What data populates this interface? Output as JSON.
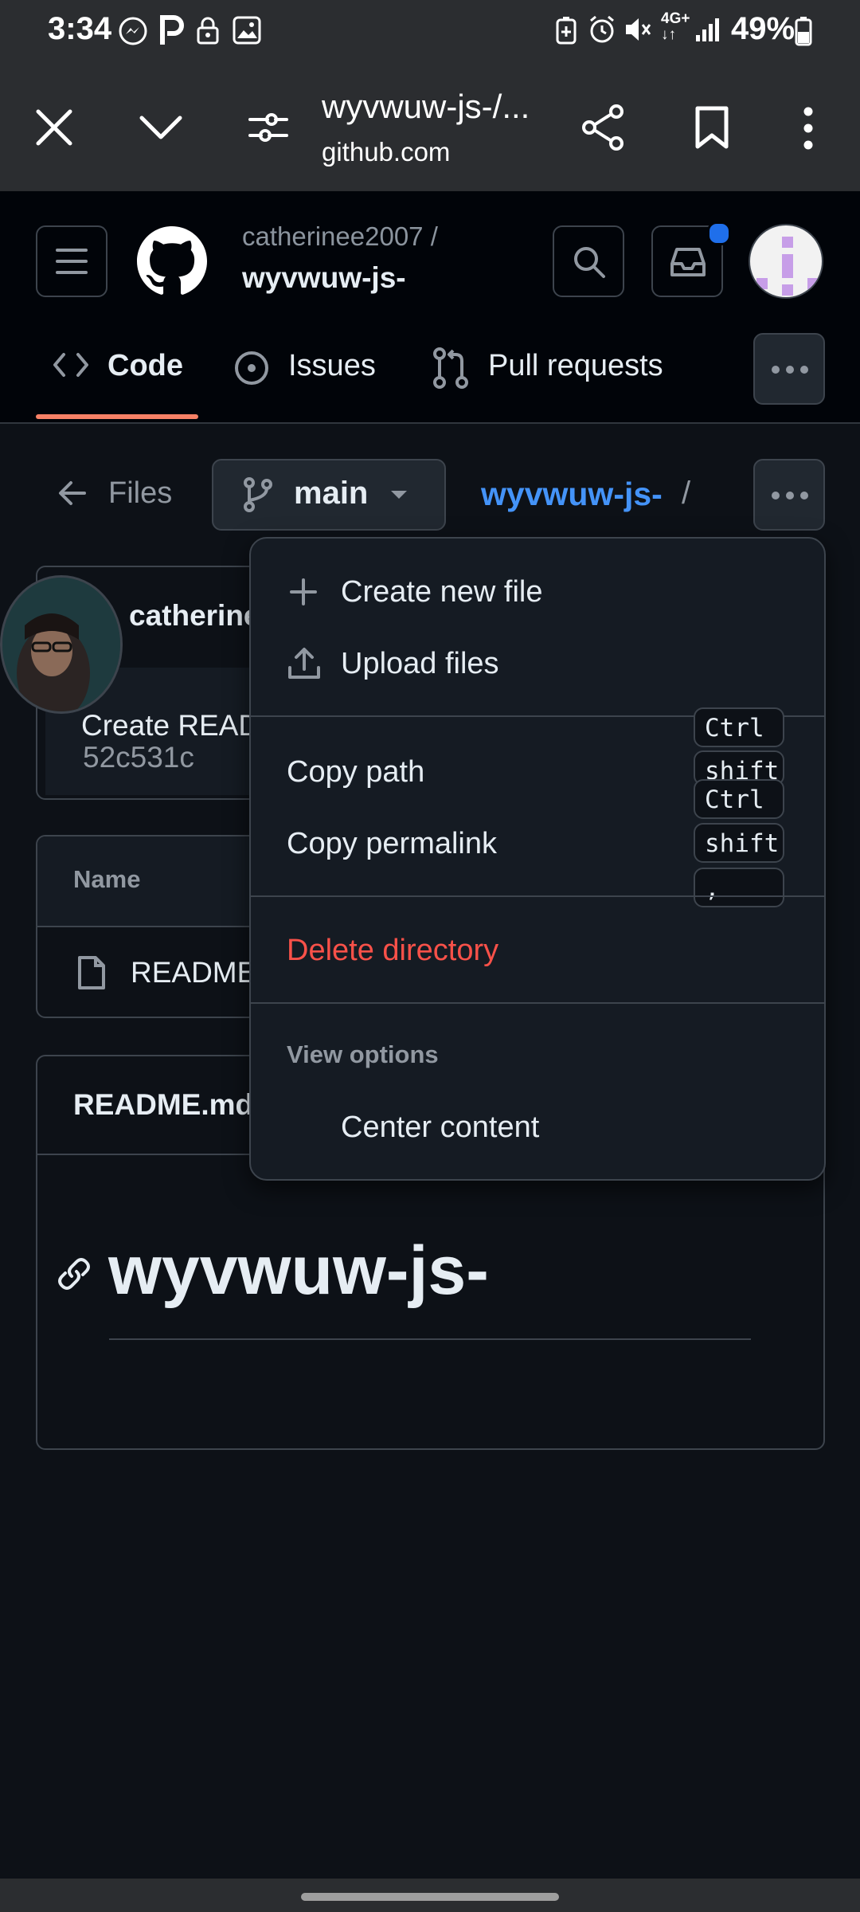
{
  "status_bar": {
    "time": "3:34",
    "network": "4G+",
    "battery": "49%"
  },
  "browser": {
    "page_title": "wyvwuw-js-/...",
    "host": "github.com"
  },
  "header": {
    "owner": "catherinee2007 /",
    "repo": "wyvwuw-js-",
    "tabs": [
      {
        "label": "Code"
      },
      {
        "label": "Issues"
      },
      {
        "label": "Pull requests"
      }
    ]
  },
  "files_bar": {
    "files_label": "Files",
    "branch": "main",
    "path": "wyvwuw-js-",
    "path_sep": "/"
  },
  "commit": {
    "author": "catherine",
    "message": "Create READ",
    "sha": "52c531c"
  },
  "file_table": {
    "header": "Name",
    "rows": [
      {
        "name": "README"
      }
    ]
  },
  "readme": {
    "header": "README.md",
    "heading": "wyvwuw-js-"
  },
  "menu": {
    "create_new_file": "Create new file",
    "upload_files": "Upload files",
    "copy_path": "Copy path",
    "copy_permalink": "Copy permalink",
    "delete_directory": "Delete directory",
    "view_options": "View options",
    "center_content": "Center content",
    "shortcuts": {
      "copy_path": [
        "Ctrl",
        "shift"
      ],
      "copy_permalink": [
        "Ctrl",
        "shift",
        ","
      ]
    }
  },
  "colors": {
    "accent_link": "#4493f8",
    "danger": "#f85149",
    "tab_underline": "#f78166",
    "notification_dot": "#1f6feb"
  }
}
